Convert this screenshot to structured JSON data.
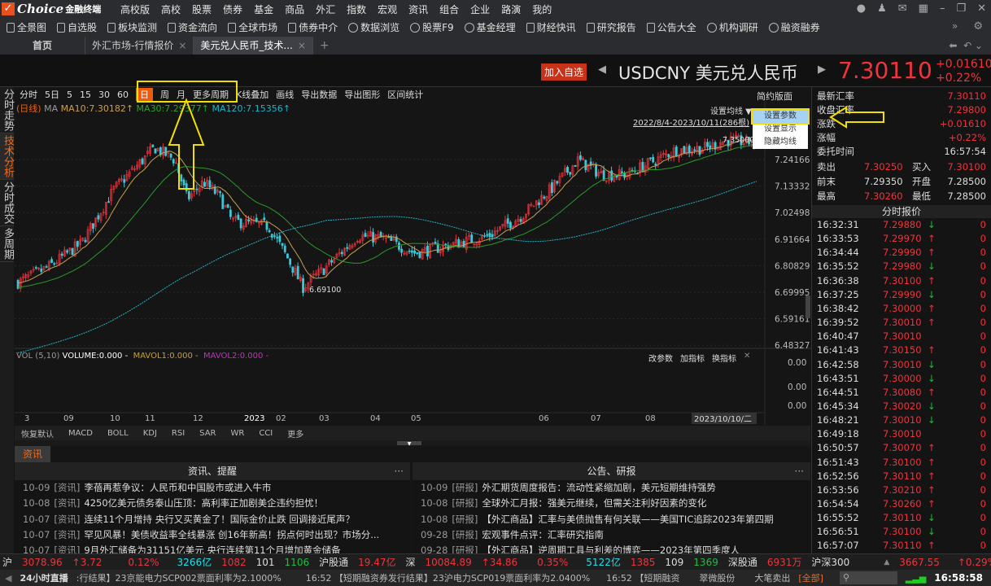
{
  "app": {
    "logo": "Choice",
    "logo_sub": "金融终端",
    "menu": [
      "高校版",
      "高校",
      "股票",
      "债券",
      "基金",
      "商品",
      "外汇",
      "指数",
      "宏观",
      "资讯",
      "组合",
      "企业",
      "路演",
      "我的"
    ]
  },
  "toolbar": [
    "全景图",
    "自选股",
    "板块监测",
    "资金流向",
    "全球市场",
    "债券中介",
    "数据浏览",
    "股票F9",
    "基金经理",
    "财经快讯",
    "研究报告",
    "公告大全",
    "机构调研",
    "融资融券"
  ],
  "tabs": [
    {
      "label": "首页"
    },
    {
      "label": "外汇市场-行情报价"
    },
    {
      "label": "美元兑人民币_技术..."
    }
  ],
  "header": {
    "add_watch": "加入自选",
    "symbol": "USDCNY",
    "name": "美元兑人民币",
    "price": "7.30110",
    "change": "+0.01610",
    "change_pct": "+0.22%"
  },
  "left_tabs": [
    "分时走势",
    "技术分析",
    "分时成交",
    "多周期"
  ],
  "chart_toolbar": {
    "items": [
      "分时",
      "5日",
      "5",
      "15",
      "30",
      "60",
      "日",
      "周",
      "月",
      "更多周期",
      "K线叠加",
      "画线",
      "导出数据",
      "导出图形",
      "区间统计"
    ],
    "active": "日"
  },
  "ma_line": {
    "type": "(日线)",
    "ma": "MA",
    "ma10": "MA10:7.30182↑",
    "ma30": "MA30:7.29377↑",
    "ma120": "MA120:7.15356↑"
  },
  "chart": {
    "simple_view": "简约版面",
    "set_ma": "设置均线 ▼",
    "range": "2022/8/4-2023/10/11(286根)",
    "high_label": "7.35000",
    "low_label": "6.69100",
    "y_ticks": [
      "7.24166",
      "7.13332",
      "7.02498",
      "6.91664",
      "6.80829",
      "6.69995",
      "6.59161",
      "6.48327"
    ],
    "x_ticks": [
      "3",
      "09",
      "10",
      "11",
      "12",
      "2023",
      "02",
      "03",
      "04",
      "05",
      "06",
      "07",
      "08"
    ],
    "cursor_date": "2023/10/10/二",
    "colors": {
      "up": "#e8323c",
      "down": "#3cc8d8",
      "ma10": "#c8a050",
      "ma30": "#2a9a2a",
      "ma120": "#1eb4c8"
    }
  },
  "dropdown": [
    "设置参数",
    "设置显示",
    "隐藏均线"
  ],
  "volume": {
    "label": "VOL (5,10)",
    "volume": "VOLUME:0.000 -",
    "mavol1": "MAVOL1:0.000 -",
    "mavol2": "MAVOL2:0.000 -",
    "tools": [
      "改参数",
      "加指标",
      "换指标"
    ],
    "y_ticks": [
      "0.00",
      "0.00",
      "0.00"
    ]
  },
  "indicators": [
    "恢复默认",
    "MACD",
    "BOLL",
    "KDJ",
    "RSI",
    "SAR",
    "WR",
    "CCI",
    "更多"
  ],
  "news": {
    "tab": "资讯",
    "left": {
      "title": "资讯、提醒",
      "items": [
        {
          "date": "10-09",
          "tag": "[资讯]",
          "text": "李蓓再惹争议：人民币和中国股市或进入牛市"
        },
        {
          "date": "10-08",
          "tag": "[资讯]",
          "text": "4250亿美元债务泰山压顶：高利率正加剧美企违约担忧！"
        },
        {
          "date": "10-07",
          "tag": "[资讯]",
          "text": "连续11个月增持 央行又买黄金了！国际金价止跌 回调接近尾声？"
        },
        {
          "date": "10-07",
          "tag": "[资讯]",
          "text": "罕见风暴！美债收益率全线暴涨 创16年新高！拐点何时出现？市场分..."
        },
        {
          "date": "10-07",
          "tag": "[资讯]",
          "text": "9月外汇储备为31151亿美元 央行连续第11个月增加黄金储备"
        }
      ]
    },
    "right": {
      "title": "公告、研报",
      "items": [
        {
          "date": "10-09",
          "tag": "[研报]",
          "text": "外汇期货周度报告：流动性紧缩加剧，美元短期维持强势"
        },
        {
          "date": "10-08",
          "tag": "[研报]",
          "text": "全球外汇月报：强美元继续，但需关注利好因素的变化"
        },
        {
          "date": "10-08",
          "tag": "[研报]",
          "text": "【外汇商品】汇率与美债抛售有何关联——美国TIC追踪2023年第四期"
        },
        {
          "date": "09-28",
          "tag": "[研报]",
          "text": "宏观事件点评：汇率研究指南"
        },
        {
          "date": "09-28",
          "tag": "[研报]",
          "text": "【外汇商品】逆周期工具与利差的博弈——2023年第四季度人"
        }
      ]
    }
  },
  "quote": {
    "rows": [
      {
        "label": "最新汇率",
        "value": "7.30110",
        "color": "red"
      },
      {
        "label": "收盘汇率",
        "value": "7.29800",
        "color": "red"
      },
      {
        "label": "涨跌",
        "value": "+0.01610",
        "color": "red"
      },
      {
        "label": "涨幅",
        "value": "+0.22%",
        "color": "red"
      },
      {
        "label": "委托时间",
        "value": "16:57:54",
        "color": "wh"
      }
    ],
    "pairs": [
      {
        "l1": "卖出",
        "v1": "7.30250",
        "c1": "red",
        "l2": "买入",
        "v2": "7.30100",
        "c2": "red"
      },
      {
        "l1": "前末",
        "v1": "7.29350",
        "c1": "wh",
        "l2": "开盘",
        "v2": "7.28500",
        "c2": "wh"
      },
      {
        "l1": "最高",
        "v1": "7.30260",
        "c1": "red",
        "l2": "最低",
        "v2": "7.28500",
        "c2": "wh"
      }
    ],
    "ticks_title": "分时报价",
    "ticks": [
      {
        "time": "16:32:31",
        "price": "7.29880",
        "dir": "down",
        "vol": "0"
      },
      {
        "time": "16:33:53",
        "price": "7.29970",
        "dir": "up",
        "vol": "0"
      },
      {
        "time": "16:34:44",
        "price": "7.29990",
        "dir": "up",
        "vol": "0"
      },
      {
        "time": "16:35:52",
        "price": "7.29980",
        "dir": "down",
        "vol": "0"
      },
      {
        "time": "16:36:38",
        "price": "7.30100",
        "dir": "up",
        "vol": "0"
      },
      {
        "time": "16:37:25",
        "price": "7.29990",
        "dir": "down",
        "vol": "0"
      },
      {
        "time": "16:38:42",
        "price": "7.30000",
        "dir": "up",
        "vol": "0"
      },
      {
        "time": "16:39:52",
        "price": "7.30010",
        "dir": "up",
        "vol": "0"
      },
      {
        "time": "16:40:47",
        "price": "7.30010",
        "dir": "",
        "vol": "0"
      },
      {
        "time": "16:41:43",
        "price": "7.30150",
        "dir": "up",
        "vol": "0"
      },
      {
        "time": "16:42:58",
        "price": "7.30010",
        "dir": "down",
        "vol": "0"
      },
      {
        "time": "16:43:51",
        "price": "7.30000",
        "dir": "down",
        "vol": "0"
      },
      {
        "time": "16:44:51",
        "price": "7.30080",
        "dir": "up",
        "vol": "0"
      },
      {
        "time": "16:45:34",
        "price": "7.30020",
        "dir": "down",
        "vol": "0"
      },
      {
        "time": "16:48:21",
        "price": "7.30010",
        "dir": "down",
        "vol": "0"
      },
      {
        "time": "16:49:18",
        "price": "7.30010",
        "dir": "",
        "vol": "0"
      },
      {
        "time": "16:50:57",
        "price": "7.30070",
        "dir": "up",
        "vol": "0"
      },
      {
        "time": "16:51:43",
        "price": "7.30100",
        "dir": "up",
        "vol": "0"
      },
      {
        "time": "16:52:56",
        "price": "7.30110",
        "dir": "up",
        "vol": "0"
      },
      {
        "time": "16:53:56",
        "price": "7.30210",
        "dir": "up",
        "vol": "0"
      },
      {
        "time": "16:54:54",
        "price": "7.30260",
        "dir": "up",
        "vol": "0"
      },
      {
        "time": "16:55:52",
        "price": "7.30110",
        "dir": "down",
        "vol": "0"
      },
      {
        "time": "16:56:51",
        "price": "7.30100",
        "dir": "down",
        "vol": "0"
      },
      {
        "time": "16:57:07",
        "price": "7.30110",
        "dir": "up",
        "vol": "0"
      }
    ]
  },
  "status": {
    "sh": "沪",
    "sh_idx": "3078.96",
    "sh_chg": "↑3.72",
    "sh_pct": "0.12%",
    "sh_amt": "3266亿",
    "sh_up": "1082",
    "sh_flat": "101",
    "sh_down": "1106",
    "hgt": "沪股通",
    "hgt_val": "19.47亿",
    "sz": "深",
    "sz_idx": "10084.89",
    "sz_chg": "↑34.86",
    "sz_pct": "0.35%",
    "sz_amt": "5122亿",
    "sz_up": "1385",
    "sz_flat": "109",
    "sz_down": "1369",
    "sgt": "深股通",
    "sgt_val": "6931万",
    "hs300": "沪深300",
    "hs300_arrow": "▲",
    "hs300_idx": "3667.55",
    "hs300_pct": "↑0.29%"
  },
  "live": {
    "label": "24小时直播",
    "items": [
      ":行结果】23京能电力SCP002票面利率为2.1000%",
      "16:52 【短期融资券发行结果】23沪电力SCP019票面利率为2.0400%",
      "16:52 【短期融资"
    ],
    "stock": "翠微股份",
    "action": "大笔卖出",
    "all": "[全部]",
    "clock": "16:58:58"
  }
}
